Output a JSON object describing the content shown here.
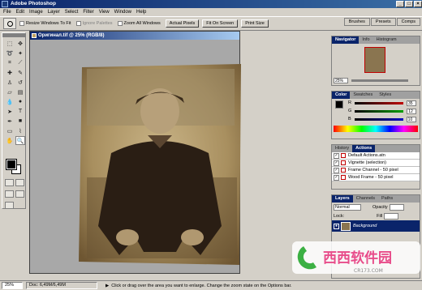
{
  "app": {
    "title": "Adobe Photoshop",
    "window_controls": [
      "_",
      "□",
      "×"
    ]
  },
  "menu": [
    "File",
    "Edit",
    "Image",
    "Layer",
    "Select",
    "Filter",
    "View",
    "Window",
    "Help"
  ],
  "options": {
    "resize_windows": "Resize Windows To Fit",
    "ignore_palettes": "Ignore Palettes",
    "zoom_all": "Zoom All Windows",
    "actual_pixels": "Actual Pixels",
    "fit_on_screen": "Fit On Screen",
    "print_size": "Print Size"
  },
  "palette_well": [
    "Brushes",
    "Presets",
    "Comps"
  ],
  "document": {
    "title": "Оригинал.tif @ 25% (RGB/8)"
  },
  "navigator": {
    "tabs": [
      "Navigator",
      "Info",
      "Histogram"
    ],
    "zoom": "25%"
  },
  "color": {
    "tabs": [
      "Color",
      "Swatches",
      "Styles"
    ],
    "channels": [
      {
        "label": "R",
        "value": "35"
      },
      {
        "label": "G",
        "value": "12"
      },
      {
        "label": "B",
        "value": "10"
      }
    ],
    "colors": {
      "fg": "#000000",
      "r": "#c00000",
      "g": "#00a000",
      "b": "#0000c0"
    }
  },
  "actions": {
    "tabs": [
      "History",
      "Actions"
    ],
    "items": [
      "Default Actions.atn",
      "Vignette (selection)",
      "Frame Channel - 50 pixel",
      "Wood Frame - 50 pixel"
    ]
  },
  "layers": {
    "tabs": [
      "Layers",
      "Channels",
      "Paths"
    ],
    "blend": "Normal",
    "opacity_label": "Opacity",
    "lock_label": "Lock:",
    "fill_label": "Fill",
    "layer_name": "Background"
  },
  "status": {
    "zoom": "25%",
    "doc": "Doc: 6,49M/6,49M",
    "hint": "Click or drag over the area you want to enlarge. Change the zoom state on the Options bar."
  },
  "watermark": {
    "text": "西西软件园",
    "sub": "CR173.COM"
  }
}
